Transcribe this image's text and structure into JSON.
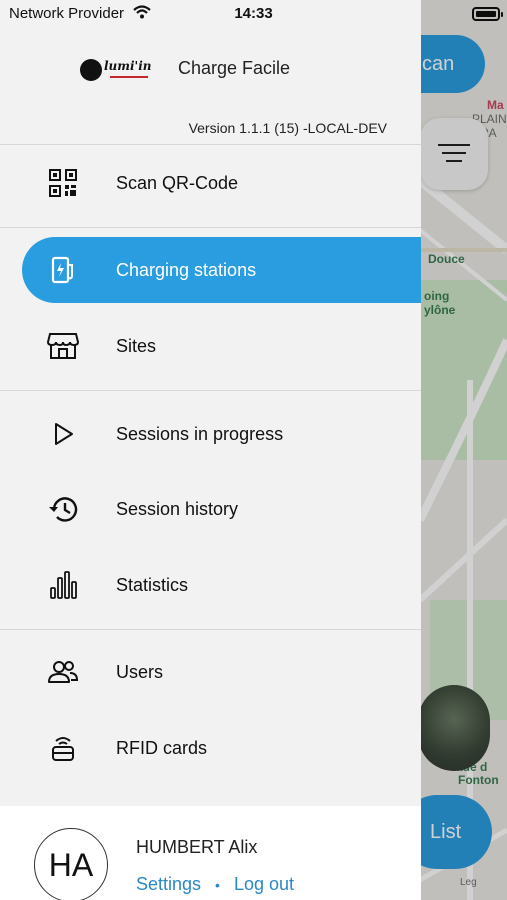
{
  "status_bar": {
    "carrier": "Network Provider",
    "time": "14:33"
  },
  "brand": {
    "logo_text": "lumi'in",
    "app_name": "Charge Facile"
  },
  "version": "Version 1.1.1 (15) -LOCAL-DEV",
  "menu": {
    "scan": "Scan QR-Code",
    "charging_stations": "Charging stations",
    "sites": "Sites",
    "sessions_in_progress": "Sessions in progress",
    "session_history": "Session history",
    "statistics": "Statistics",
    "users": "Users",
    "rfid_cards": "RFID cards"
  },
  "footer": {
    "initials": "HA",
    "user_name": "HUMBERT Alix",
    "settings": "Settings",
    "logout": "Log out",
    "separator": "•"
  },
  "background": {
    "scan_button": "can",
    "list_button": "List",
    "map_labels": [
      "Douce",
      "oing",
      "ylône",
      "PLAIN",
      "BRA",
      "Ma",
      "tade d",
      "Fonton",
      "Leg"
    ]
  },
  "colors": {
    "accent": "#2a9de0",
    "link": "#2a88c8",
    "drawer_bg": "#f2f2f2"
  },
  "icons": {
    "scan": "qr-code-icon",
    "charging_stations": "ev-charger-icon",
    "sites": "storefront-icon",
    "sessions_in_progress": "play-icon",
    "session_history": "history-icon",
    "statistics": "bar-chart-icon",
    "users": "users-icon",
    "rfid_cards": "rfid-card-icon"
  }
}
